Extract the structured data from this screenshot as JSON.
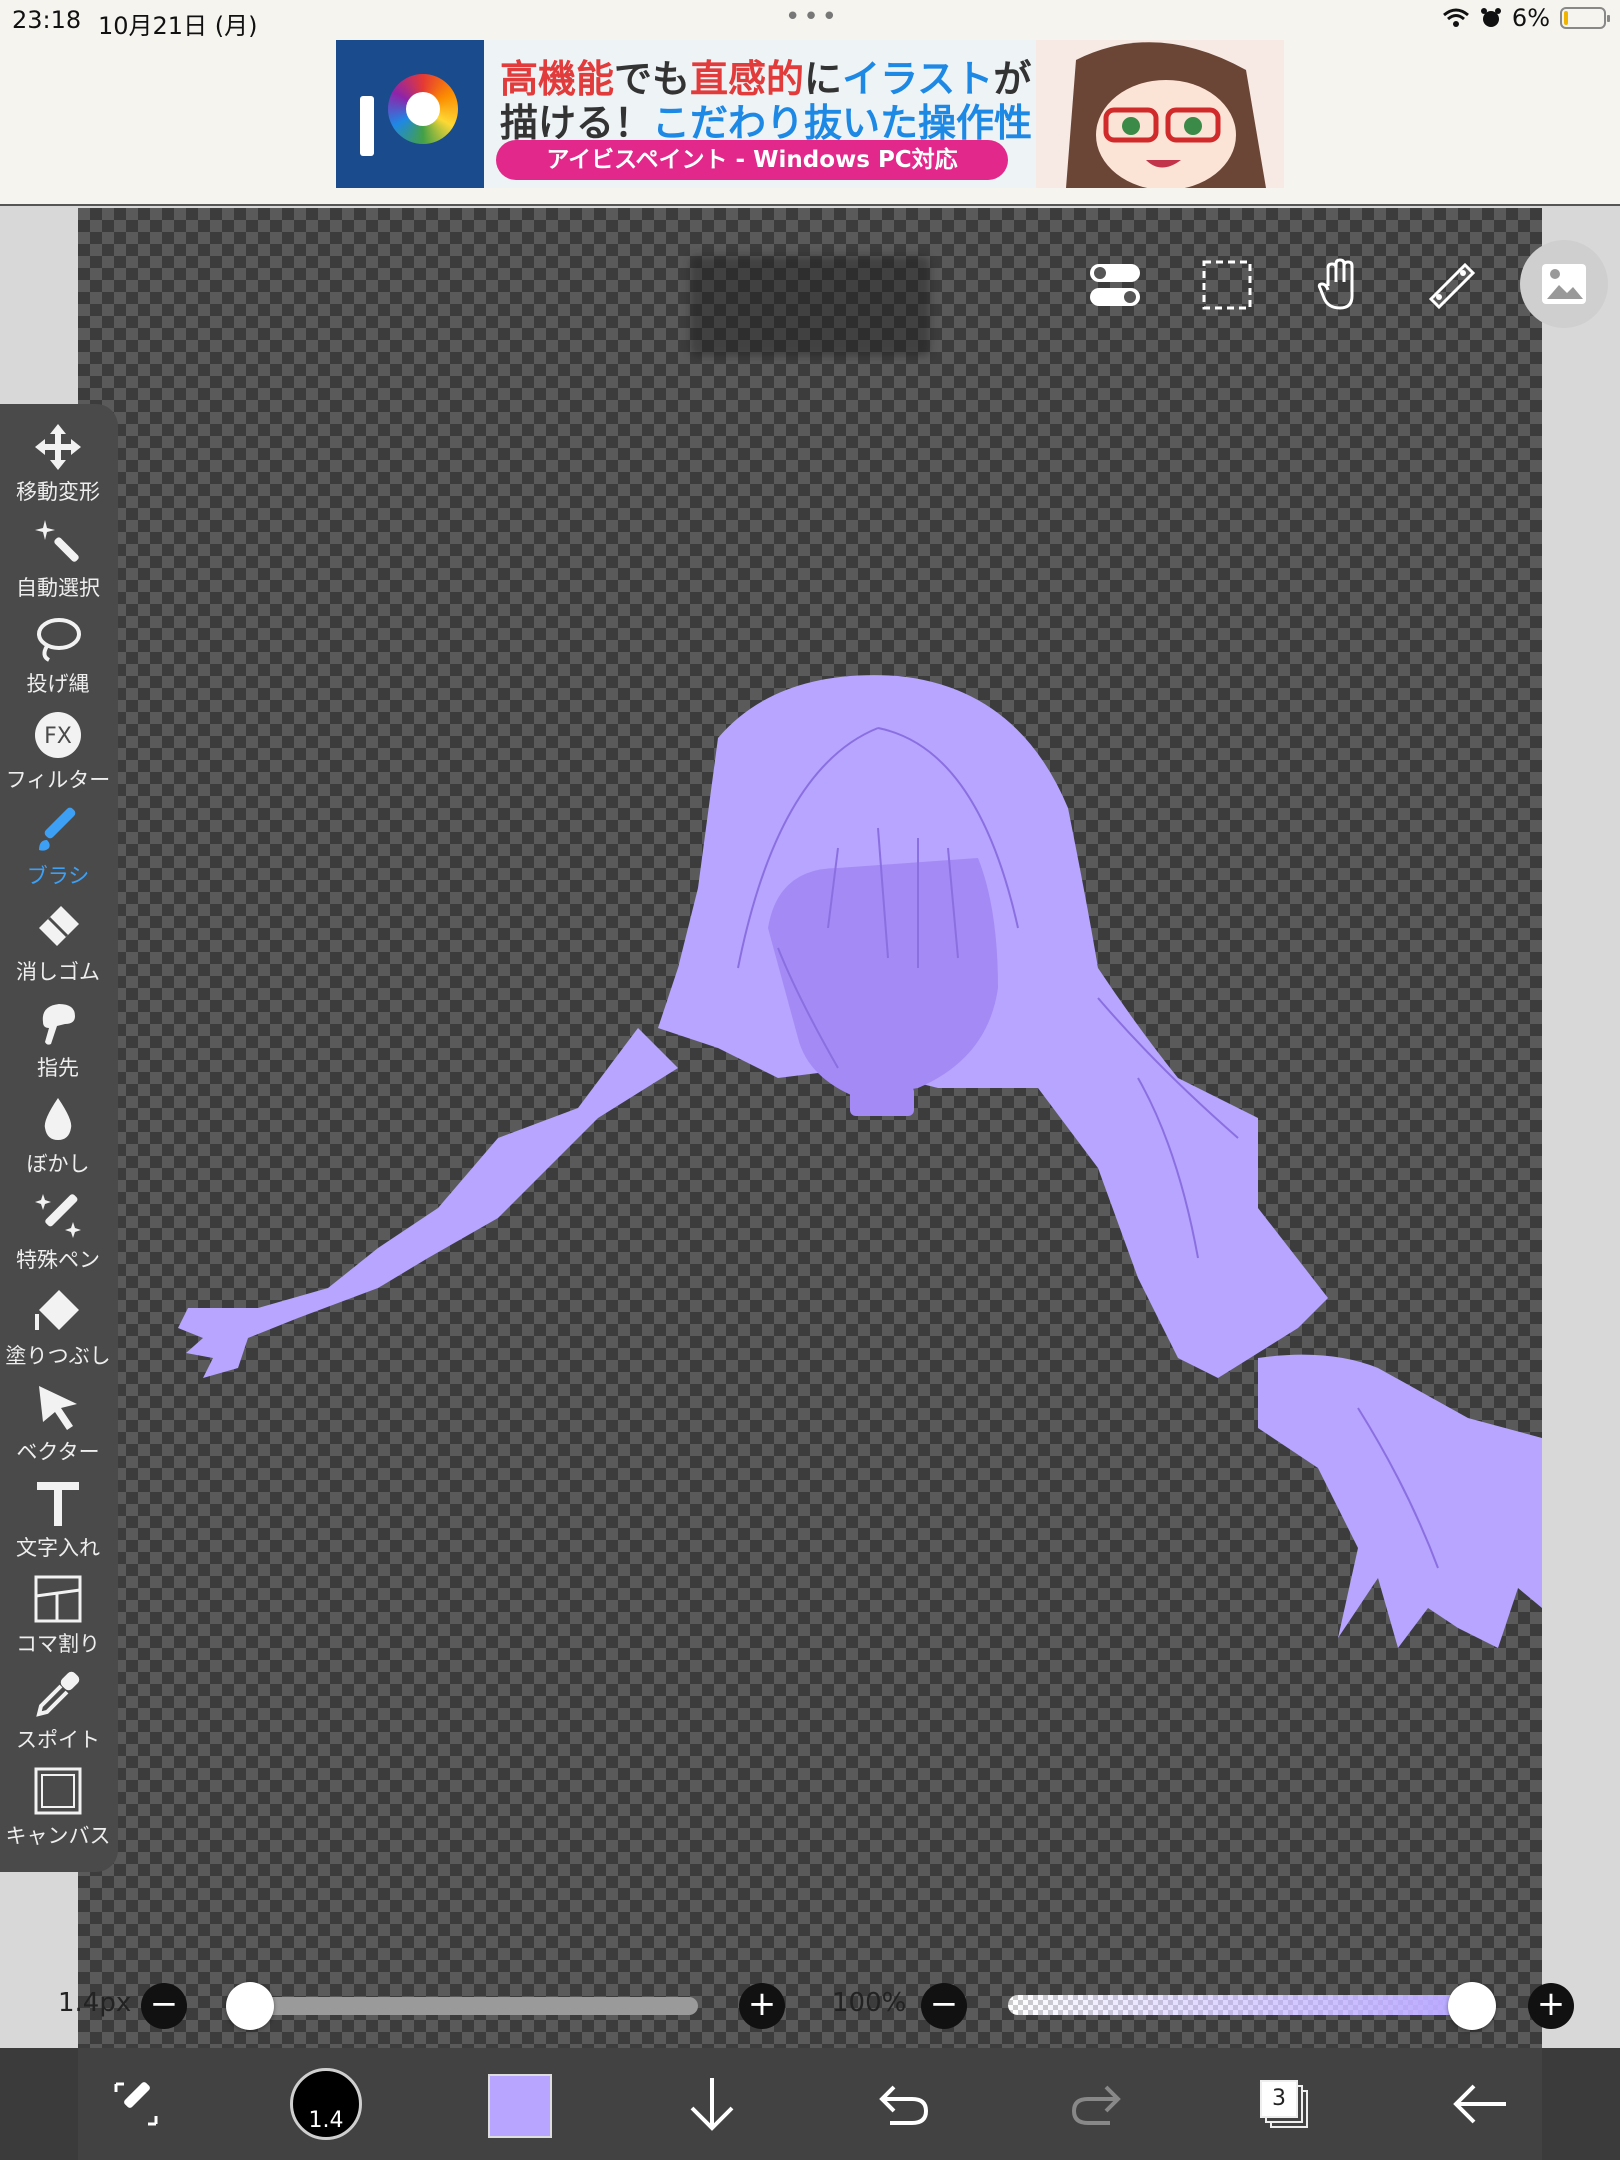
{
  "status_bar": {
    "time": "23:18",
    "date": "10月21日 (月)",
    "battery_text": "6%",
    "icons": [
      "wifi-icon",
      "alarm-icon",
      "battery-icon"
    ]
  },
  "ad": {
    "line1_part1": "高機能",
    "line1_part2": "でも",
    "line1_part3": "直感的",
    "line1_part4": "に",
    "line1_part5": "イラスト",
    "line1_part6": "が",
    "line2_part1": "描ける！",
    "line2_part2": "こだわり抜いた",
    "line2_part3": "操作性！",
    "pill": "アイビスペイント - Windows PC対応"
  },
  "top_tools": [
    "toggle-icon",
    "selection-icon",
    "hand-icon",
    "ruler-icon",
    "reference-image-icon"
  ],
  "tools": [
    {
      "name": "move-transform",
      "label": "移動変形",
      "icon": "move-icon"
    },
    {
      "name": "magic-wand",
      "label": "自動選択",
      "icon": "magic-wand-icon"
    },
    {
      "name": "lasso",
      "label": "投げ縄",
      "icon": "lasso-icon"
    },
    {
      "name": "filter",
      "label": "フィルター",
      "icon": "fx-icon"
    },
    {
      "name": "brush",
      "label": "ブラシ",
      "icon": "brush-icon",
      "active": true
    },
    {
      "name": "eraser",
      "label": "消しゴム",
      "icon": "eraser-icon"
    },
    {
      "name": "smudge",
      "label": "指先",
      "icon": "finger-icon"
    },
    {
      "name": "blur",
      "label": "ぼかし",
      "icon": "drop-icon"
    },
    {
      "name": "special-pen",
      "label": "特殊ペン",
      "icon": "sparkle-pen-icon"
    },
    {
      "name": "fill",
      "label": "塗りつぶし",
      "icon": "bucket-icon"
    },
    {
      "name": "vector",
      "label": "ベクター",
      "icon": "cursor-icon"
    },
    {
      "name": "text",
      "label": "文字入れ",
      "icon": "text-icon"
    },
    {
      "name": "frame-divider",
      "label": "コマ割り",
      "icon": "frame-icon"
    },
    {
      "name": "eyedropper",
      "label": "スポイト",
      "icon": "eyedropper-icon"
    },
    {
      "name": "canvas",
      "label": "キャンバス",
      "icon": "canvas-icon"
    }
  ],
  "sliders": {
    "brush_size_label": "1.4px",
    "brush_size_fraction": 0.0,
    "opacity_label": "100%",
    "opacity_fraction": 1.0,
    "minus": "−",
    "plus": "+"
  },
  "bottom_bar": {
    "brush_size_value": "1.4",
    "current_color": "#b7a5ff",
    "layer_count": "3",
    "icons": [
      "brush-swap-icon",
      "brush-size-indicator",
      "color-swatch",
      "arrow-down-icon",
      "undo-icon",
      "redo-icon",
      "layers-icon",
      "back-arrow-icon"
    ]
  },
  "colors": {
    "accent_blue": "#3da0f5",
    "hair_fill": "#b7a5ff",
    "face_fill": "#a48af5",
    "line_color": "#8a6fe0"
  }
}
